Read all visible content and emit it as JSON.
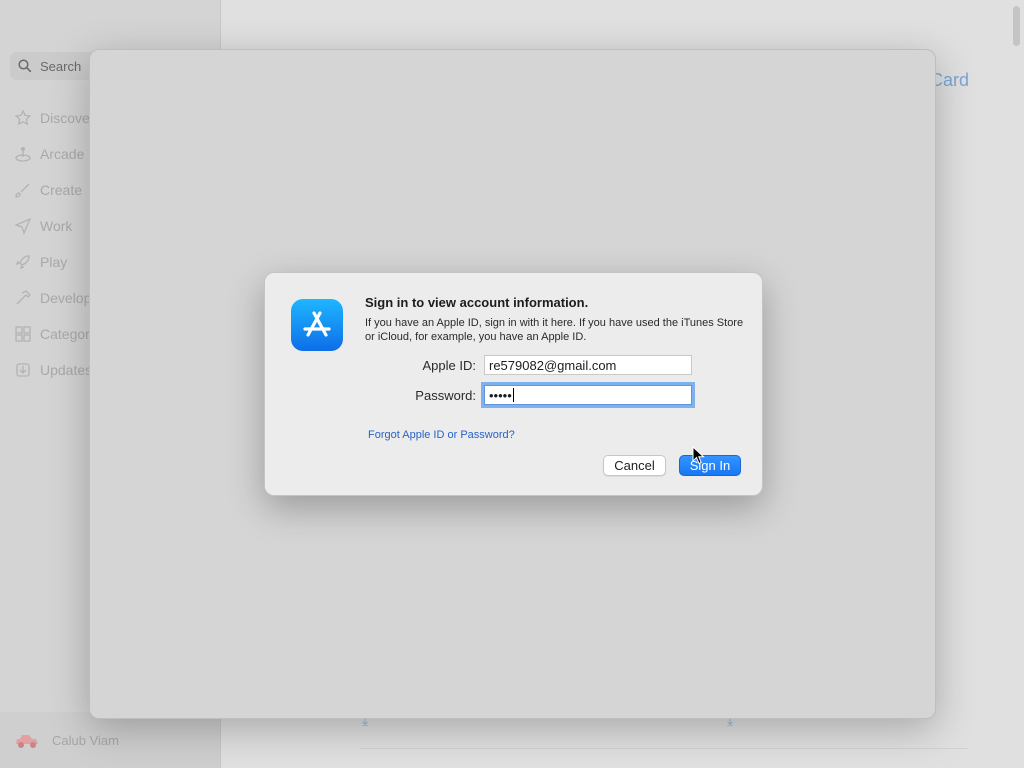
{
  "sidebar": {
    "search_placeholder": "Search",
    "items": [
      {
        "label": "Discover",
        "icon": "star-icon"
      },
      {
        "label": "Arcade",
        "icon": "joystick-icon"
      },
      {
        "label": "Create",
        "icon": "brush-icon"
      },
      {
        "label": "Work",
        "icon": "paper-plane-icon"
      },
      {
        "label": "Play",
        "icon": "rocket-icon"
      },
      {
        "label": "Develop",
        "icon": "hammer-icon"
      },
      {
        "label": "Categories",
        "icon": "grid-icon"
      },
      {
        "label": "Updates",
        "icon": "download-icon"
      }
    ],
    "user_name": "Calub Viam"
  },
  "main": {
    "card_link": "Card"
  },
  "dialog": {
    "title": "Sign in to view account information.",
    "body": "If you have an Apple ID, sign in with it here. If you have used the iTunes Store or iCloud, for example, you have an Apple ID.",
    "apple_id_label": "Apple ID:",
    "apple_id_value": "re579082@gmail.com",
    "password_label": "Password:",
    "password_masked": "•••••",
    "forgot_link": "Forgot Apple ID or Password?",
    "cancel_label": "Cancel",
    "signin_label": "Sign In"
  },
  "colors": {
    "accent": "#1877f2",
    "link": "#2563c9",
    "focus_ring": "#7fb1ec"
  }
}
